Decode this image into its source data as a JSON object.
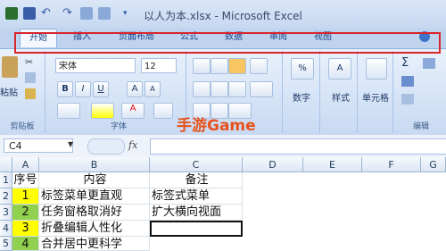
{
  "window": {
    "title": "以人为本.xlsx - Microsoft Excel"
  },
  "tabs": [
    "开始",
    "插入",
    "页面布局",
    "公式",
    "数据",
    "审阅",
    "视图"
  ],
  "ribbon": {
    "clipboard": {
      "paste_label": "粘贴",
      "group_label": "剪贴板"
    },
    "font": {
      "font_name": "宋体",
      "font_size": "12",
      "bold": "B",
      "italic": "I",
      "underline": "U",
      "grow": "A",
      "shrink": "A",
      "group_label": "字体"
    },
    "number": {
      "label": "数字",
      "percent": "%"
    },
    "styles": {
      "label": "样式"
    },
    "cells": {
      "label": "单元格"
    },
    "editing": {
      "label": "编辑",
      "sum": "Σ"
    }
  },
  "watermark": "手游Game",
  "formula_bar": {
    "name_box": "C4",
    "fx": "fx",
    "value": ""
  },
  "sheet": {
    "columns": [
      "A",
      "B",
      "C",
      "D",
      "E",
      "F",
      "G"
    ],
    "rows": [
      {
        "n": "1",
        "a": "序号",
        "b": "内容",
        "c": "备注"
      },
      {
        "n": "2",
        "a": "1",
        "b": "标签菜单更直观",
        "c": "标签式菜单"
      },
      {
        "n": "3",
        "a": "2",
        "b": "任务窗格取消好",
        "c": "扩大横向视面"
      },
      {
        "n": "4",
        "a": "3",
        "b": "折叠编辑人性化",
        "c": ""
      },
      {
        "n": "5",
        "a": "4",
        "b": "合并居中更科学",
        "c": ""
      }
    ],
    "highlight_color": "#ffff00",
    "selected_cell": "C4"
  },
  "colors": {
    "annotation": "#d7262c",
    "watermark": "#e8521c"
  }
}
